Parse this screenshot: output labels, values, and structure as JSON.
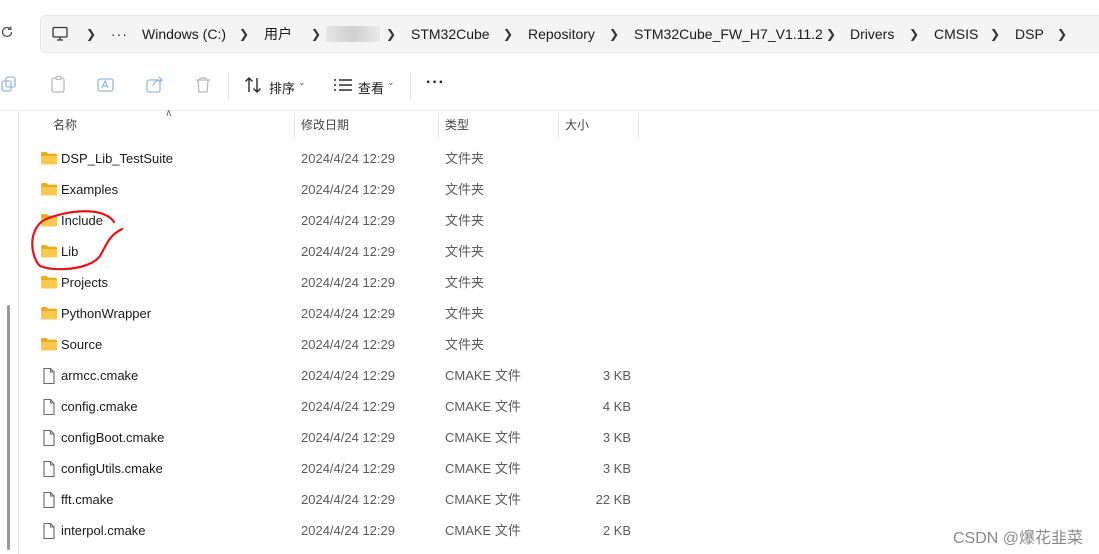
{
  "address_bar": {
    "overflow_label": "···",
    "crumbs": [
      "Windows (C:)",
      "用户",
      "STM32Cube",
      "Repository",
      "STM32Cube_FW_H7_V1.11.2",
      "Drivers",
      "CMSIS",
      "DSP"
    ]
  },
  "toolbar": {
    "sort_label": "排序",
    "view_label": "查看",
    "more_label": "···"
  },
  "columns": {
    "name": "名称",
    "date": "修改日期",
    "type": "类型",
    "size": "大小"
  },
  "rows": [
    {
      "name": "DSP_Lib_TestSuite",
      "date": "2024/4/24 12:29",
      "type": "文件夹",
      "size": "",
      "icon": "folder-icon"
    },
    {
      "name": "Examples",
      "date": "2024/4/24 12:29",
      "type": "文件夹",
      "size": "",
      "icon": "folder-icon"
    },
    {
      "name": "Include",
      "date": "2024/4/24 12:29",
      "type": "文件夹",
      "size": "",
      "icon": "folder-icon"
    },
    {
      "name": "Lib",
      "date": "2024/4/24 12:29",
      "type": "文件夹",
      "size": "",
      "icon": "folder-icon"
    },
    {
      "name": "Projects",
      "date": "2024/4/24 12:29",
      "type": "文件夹",
      "size": "",
      "icon": "folder-icon"
    },
    {
      "name": "PythonWrapper",
      "date": "2024/4/24 12:29",
      "type": "文件夹",
      "size": "",
      "icon": "folder-icon"
    },
    {
      "name": "Source",
      "date": "2024/4/24 12:29",
      "type": "文件夹",
      "size": "",
      "icon": "folder-icon"
    },
    {
      "name": "armcc.cmake",
      "date": "2024/4/24 12:29",
      "type": "CMAKE 文件",
      "size": "3 KB",
      "icon": "file-icon"
    },
    {
      "name": "config.cmake",
      "date": "2024/4/24 12:29",
      "type": "CMAKE 文件",
      "size": "4 KB",
      "icon": "file-icon"
    },
    {
      "name": "configBoot.cmake",
      "date": "2024/4/24 12:29",
      "type": "CMAKE 文件",
      "size": "3 KB",
      "icon": "file-icon"
    },
    {
      "name": "configUtils.cmake",
      "date": "2024/4/24 12:29",
      "type": "CMAKE 文件",
      "size": "3 KB",
      "icon": "file-icon"
    },
    {
      "name": "fft.cmake",
      "date": "2024/4/24 12:29",
      "type": "CMAKE 文件",
      "size": "22 KB",
      "icon": "file-icon"
    },
    {
      "name": "interpol.cmake",
      "date": "2024/4/24 12:29",
      "type": "CMAKE 文件",
      "size": "2 KB",
      "icon": "file-icon"
    }
  ],
  "watermark": "CSDN @爆花韭菜",
  "colors": {
    "folder": "#f8c94c",
    "folder_dark": "#e9ac1f",
    "annotation": "#e3151a",
    "address_bg": "#f4f4f4"
  }
}
